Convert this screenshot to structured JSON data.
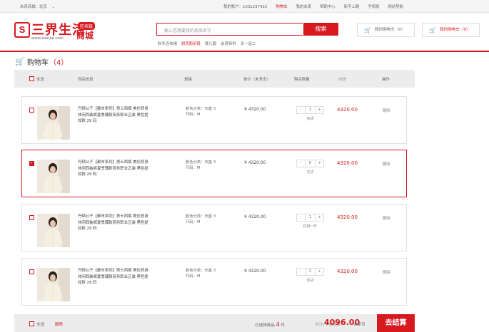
{
  "topbar": {
    "location": "未来商城：北京",
    "location_arrow": "⌄",
    "links": [
      "我的账户：1031237422",
      "购物车",
      "我的未来",
      "帮助中心",
      "新手上路",
      "手机版",
      "网站导航"
    ],
    "active_index": 1
  },
  "logo": {
    "mark": "S",
    "name": "三界生活",
    "badge": "区块链",
    "sub": "商城",
    "url": "www.isanjie.com"
  },
  "search": {
    "placeholder": "输入您想要找的商品名字",
    "button": "搜索",
    "hotwords": [
      "秋冬连衣裙",
      "耐克跑步鞋",
      "婴儿服",
      "会员特供",
      "买一送二"
    ],
    "hot_active_index": 1
  },
  "header_carts": [
    "我的购物车（0）",
    "我的购物车（0）"
  ],
  "page": {
    "title": "购物车",
    "count": "（4）"
  },
  "table_header": {
    "select_all": "全选",
    "product": "商品信息",
    "spec": "规格",
    "unit_price": "单价（未来币）",
    "quantity": "购买数量",
    "subtotal": "小计",
    "action": "操作"
  },
  "items": [
    {
      "checked": false,
      "description": "丹顿公子【都市系列】男士西裤 美伦修身休闲西装裤夏季薄款商务职业正装 黑色提纹款 29 码",
      "spec_category": "颜色分类：天蓝 3",
      "spec_size": "尺码：M",
      "price": "¥ 4320.00",
      "qty": "2",
      "stock": "有货",
      "subtotal": "4320.00",
      "delete": "删除",
      "selected": false
    },
    {
      "checked": true,
      "description": "丹顿公子【都市系列】男士西裤 美伦修身休闲西装裤夏季薄款商务职业正装 黑色提纹款 29 码",
      "spec_category": "颜色分类：天蓝 3",
      "spec_size": "尺码：M",
      "price": "¥ 4320.00",
      "qty": "0",
      "stock": "无货",
      "subtotal": "4320.00",
      "delete": "删除",
      "selected": true
    },
    {
      "checked": false,
      "description": "丹顿公子【都市系列】男士西裤 美伦修身休闲西装裤夏季薄款商务职业正装 黑色提纹款 29 码",
      "spec_category": "颜色分类：天蓝 3",
      "spec_size": "尺码：M",
      "price": "¥ 4320.00",
      "qty": "1",
      "stock": "仅剩一件",
      "subtotal": "4320.00",
      "delete": "删除",
      "selected": false
    },
    {
      "checked": false,
      "description": "丹顿公子【都市系列】男士西裤 美伦修身休闲西装裤夏季薄款商务职业正装 黑色提纹款 29 码",
      "spec_category": "颜色分类：天蓝 3",
      "spec_size": "尺码：M",
      "price": "¥ 4320.00",
      "qty": "2",
      "stock": "有货",
      "subtotal": "4320.00",
      "delete": "删除",
      "selected": false
    }
  ],
  "qty_minus": "-",
  "qty_plus": "+",
  "footer": {
    "select_all": "全选",
    "delete": "删除",
    "selected_prefix": "已选择商品",
    "selected_count": "4",
    "selected_suffix": "件",
    "total_label": "合计(不含运费)",
    "total": "4096.00",
    "unit": "未来币",
    "checkout": "去结算"
  },
  "colors": {
    "brand_red": "#d71920",
    "header_gray": "#ececec"
  }
}
